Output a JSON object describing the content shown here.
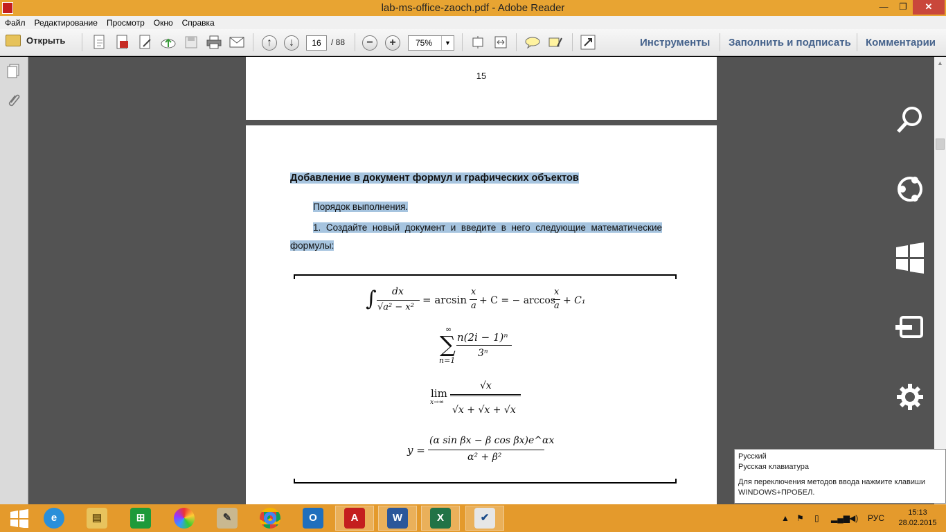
{
  "window": {
    "title": "lab-ms-office-zaoch.pdf - Adobe Reader",
    "min_glyph": "—",
    "max_glyph": "❐",
    "close_glyph": "✕"
  },
  "menu": [
    "Файл",
    "Редактирование",
    "Просмотр",
    "Окно",
    "Справка"
  ],
  "toolbar": {
    "open_label": "Открыть",
    "page_current": "16",
    "page_total": "/ 88",
    "zoom": "75%",
    "tools_label": "Инструменты",
    "fill_sign_label": "Заполнить и подписать",
    "comments_label": "Комментарии"
  },
  "document": {
    "page_number": "15",
    "heading": "Добавление в документ формул и графических объектов",
    "paragraph1": "Порядок выполнения.",
    "paragraph2": "1.  Создайте новый документ и введите в него следующие математические формулы:",
    "formulas": {
      "f1_num": "dx",
      "f1_den": "√a² − x²",
      "f1_mid": "= arcsin",
      "f1_x1": "x",
      "f1_a1": "a",
      "f1_c": "+ C = − arccos",
      "f1_x2": "x",
      "f1_a2": "a",
      "f1_end": "+ C₁",
      "f2_top": "∞",
      "f2_sigma": "∑",
      "f2_bottom": "n=1",
      "f2_num": "n(2i − 1)ⁿ",
      "f2_den": "3ⁿ",
      "f3_lim": "lim",
      "f3_sub": "x→∞",
      "f3_num": "√x",
      "f3_den": "√x + √x + √x",
      "f4_lhs": "y =",
      "f4_num": "(α sin βx − β cos βx)e^αx",
      "f4_den": "α² + β²"
    }
  },
  "tooltip": {
    "line1": "Русский",
    "line2": "Русская клавиатура",
    "line3": "Для переключения методов ввода нажмите клавиши WINDOWS+ПРОБЕЛ."
  },
  "taskbar": {
    "lang": "РУС",
    "time": "15:13",
    "date": "28.02.2015"
  },
  "colors": {
    "accent": "#e49a2c",
    "highlight": "#a6c4df",
    "doc_bg": "#535353"
  }
}
